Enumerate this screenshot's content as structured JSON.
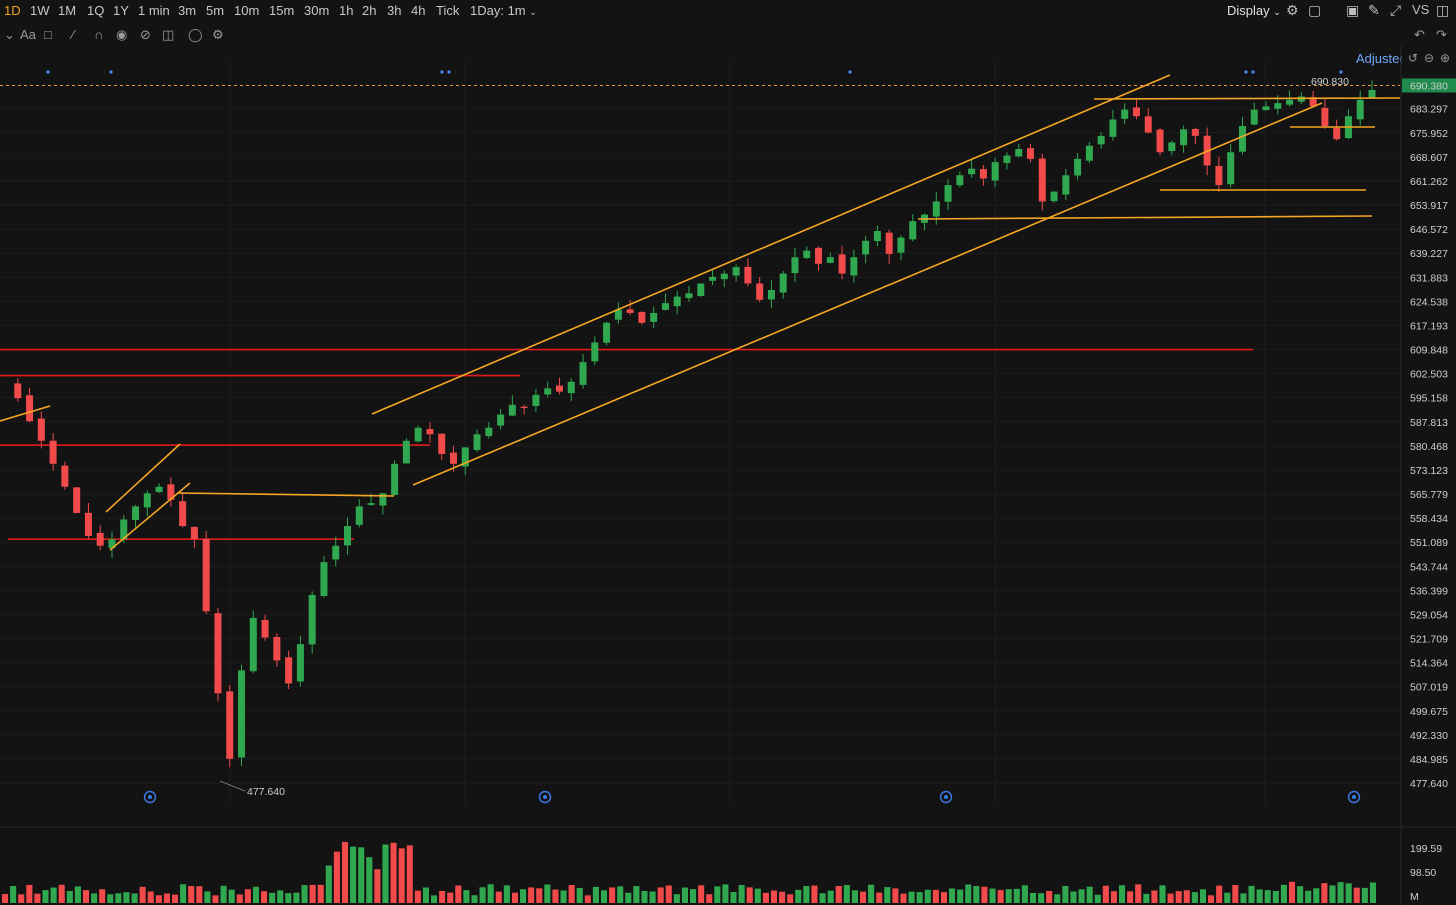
{
  "toolbar": {
    "left_marker": "1D",
    "timeframes": [
      "1W",
      "1M",
      "1Q",
      "1Y",
      "1 min",
      "3m",
      "5m",
      "10m",
      "15m",
      "30m",
      "1h",
      "2h",
      "3h",
      "4h",
      "Tick"
    ],
    "timeframe_dropdown": "1Day: 1m",
    "display_label": "Display",
    "vs_label": "VS",
    "text_tool_label": "Aa"
  },
  "adjusted_label": "Adjusted",
  "price_axis": {
    "labels": [
      "683.297",
      "675.952",
      "668.607",
      "661.262",
      "653.917",
      "646.572",
      "639.227",
      "631.883",
      "624.538",
      "617.193",
      "609.848",
      "602.503",
      "595.158",
      "587.813",
      "580.468",
      "573.123",
      "565.779",
      "558.434",
      "551.089",
      "543.744",
      "536.399",
      "529.054",
      "521.709",
      "514.364",
      "507.019",
      "499.675",
      "492.330",
      "484.985",
      "477.640"
    ],
    "current_price": "690.380",
    "high_label": "690.830",
    "low_label": "477.640"
  },
  "volume_axis": {
    "labels": [
      "199.59",
      "98.50",
      "M"
    ]
  },
  "colors": {
    "up": "#2fa84f",
    "down": "#f04a4a",
    "trendline": "#f5a623",
    "support": "#e01b1b",
    "current_price_tag": "#1f8b4c"
  },
  "chart_data": {
    "type": "candlestick",
    "price_range": [
      477.64,
      690.83
    ],
    "close_series": [
      600,
      595,
      588,
      582,
      575,
      568,
      560,
      553,
      550,
      552,
      558,
      562,
      566,
      568,
      564,
      556,
      552,
      530,
      505,
      485,
      512,
      528,
      522,
      515,
      508,
      520,
      535,
      545,
      550,
      556,
      562,
      563,
      566,
      575,
      582,
      586,
      584,
      578,
      575,
      580,
      584,
      586,
      590,
      593,
      592,
      596,
      598,
      597,
      600,
      606,
      612,
      618,
      622,
      621,
      618,
      621,
      624,
      626,
      627,
      630,
      632,
      633,
      635,
      630,
      625,
      628,
      633,
      638,
      640,
      636,
      638,
      633,
      638,
      643,
      646,
      639,
      644,
      649,
      651,
      655,
      660,
      663,
      665,
      662,
      667,
      669,
      671,
      668,
      655,
      658,
      663,
      668,
      672,
      675,
      680,
      683,
      681,
      676,
      670,
      673,
      677,
      675,
      666,
      660,
      670,
      678,
      683,
      684,
      685,
      686,
      687,
      684,
      678,
      674,
      681,
      686,
      689
    ],
    "volume_range_max": 199.59,
    "annotations": {
      "high": 690.83,
      "low": 477.64,
      "last": 690.38
    },
    "horizontal_levels": [
      609.848,
      601.9,
      580.7,
      552.0
    ],
    "grid": true
  }
}
